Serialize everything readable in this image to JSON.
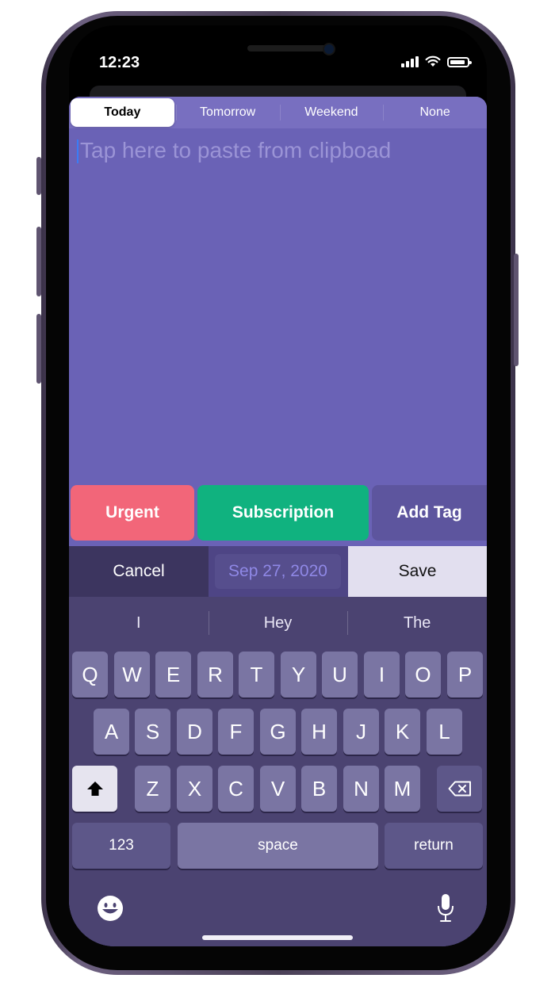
{
  "status_bar": {
    "time": "12:23"
  },
  "segments": [
    {
      "label": "Today",
      "active": true
    },
    {
      "label": "Tomorrow",
      "active": false
    },
    {
      "label": "Weekend",
      "active": false
    },
    {
      "label": "None",
      "active": false
    }
  ],
  "editor": {
    "placeholder": "Tap here to paste from clipboad"
  },
  "tags": {
    "urgent": "Urgent",
    "subscription": "Subscription",
    "add_tag": "Add Tag"
  },
  "actions": {
    "cancel": "Cancel",
    "date": "Sep 27, 2020",
    "save": "Save"
  },
  "keyboard": {
    "suggestions": [
      "I",
      "Hey",
      "The"
    ],
    "row1": [
      "Q",
      "W",
      "E",
      "R",
      "T",
      "Y",
      "U",
      "I",
      "O",
      "P"
    ],
    "row2": [
      "A",
      "S",
      "D",
      "F",
      "G",
      "H",
      "J",
      "K",
      "L"
    ],
    "row3": [
      "Z",
      "X",
      "C",
      "V",
      "B",
      "N",
      "M"
    ],
    "numbers_key": "123",
    "space_key": "space",
    "return_key": "return",
    "icons": {
      "shift": "shift-icon",
      "backspace": "backspace-icon",
      "emoji": "emoji-icon",
      "mic": "microphone-icon"
    }
  },
  "colors": {
    "app_background": "#6a62b6",
    "urgent": "#f26679",
    "subscription": "#10b27f",
    "add_tag": "#5d559e",
    "keyboard": "#4b4371",
    "date_text": "#8f88e6"
  }
}
